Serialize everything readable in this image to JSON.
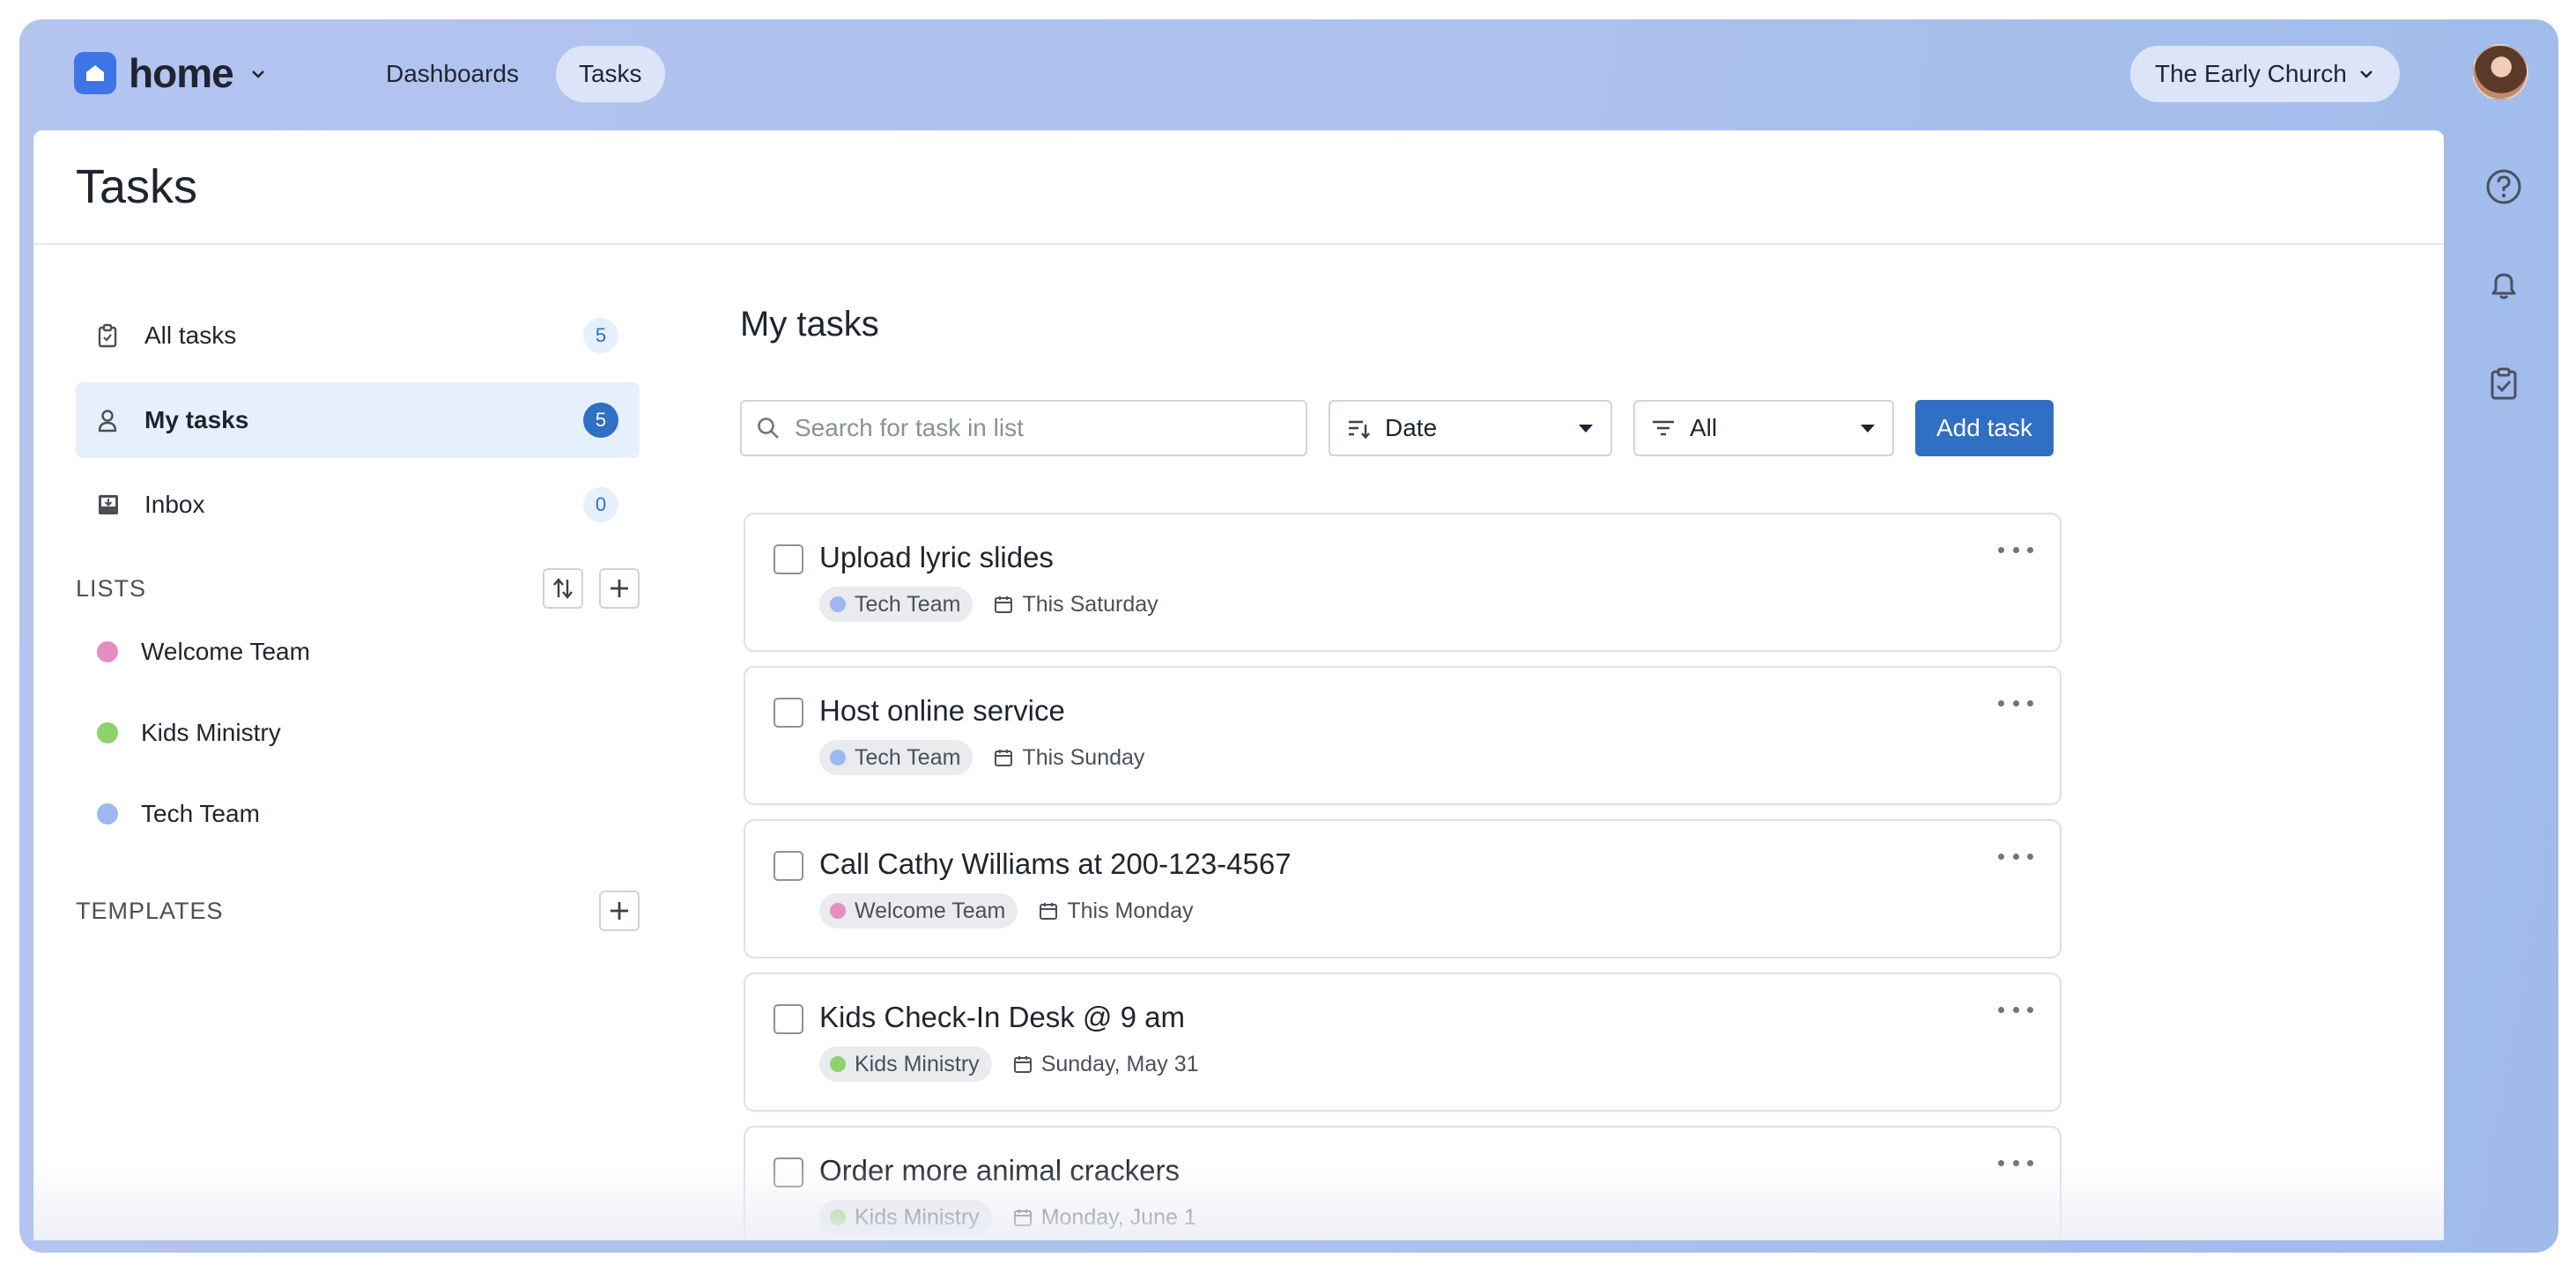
{
  "app": {
    "name": "home"
  },
  "topnav": {
    "dashboards": "Dashboards",
    "tasks": "Tasks"
  },
  "org": {
    "name": "The Early Church"
  },
  "page": {
    "title": "Tasks"
  },
  "sidebar": {
    "items": [
      {
        "label": "All tasks",
        "count": "5"
      },
      {
        "label": "My tasks",
        "count": "5"
      },
      {
        "label": "Inbox",
        "count": "0"
      }
    ],
    "lists_label": "LISTS",
    "lists": [
      {
        "label": "Welcome Team",
        "color": "#e48ec1"
      },
      {
        "label": "Kids Ministry",
        "color": "#8ed26e"
      },
      {
        "label": "Tech Team",
        "color": "#9db8f0"
      }
    ],
    "templates_label": "TEMPLATES"
  },
  "main": {
    "title": "My tasks",
    "search_placeholder": "Search for task in list",
    "sort_label": "Date",
    "filter_label": "All",
    "add_label": "Add task"
  },
  "tasks": [
    {
      "title": "Upload lyric slides",
      "tag": "Tech Team",
      "tag_color": "#9db8f0",
      "date": "This Saturday"
    },
    {
      "title": "Host online service",
      "tag": "Tech Team",
      "tag_color": "#9db8f0",
      "date": "This Sunday"
    },
    {
      "title": "Call Cathy Williams at 200-123-4567",
      "tag": "Welcome Team",
      "tag_color": "#e48ec1",
      "date": "This Monday"
    },
    {
      "title": "Kids Check-In Desk @ 9 am",
      "tag": "Kids Ministry",
      "tag_color": "#8ed26e",
      "date": "Sunday, May 31"
    },
    {
      "title": "Order more animal crackers",
      "tag": "Kids Ministry",
      "tag_color": "#8ed26e",
      "date": "Monday, June 1"
    }
  ],
  "colors": {
    "accent": "#2f6fc4",
    "brand": "#3d74e6"
  }
}
